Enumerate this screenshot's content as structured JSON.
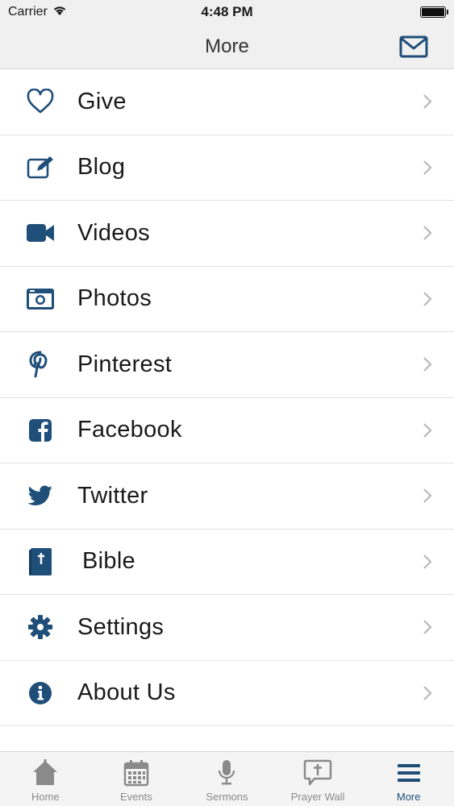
{
  "status_bar": {
    "carrier": "Carrier",
    "time": "4:48 PM"
  },
  "nav": {
    "title": "More"
  },
  "colors": {
    "accent": "#1f4e79",
    "tab_inactive": "#8a8a8a"
  },
  "menu": [
    {
      "label": "Give",
      "icon": "heart-icon"
    },
    {
      "label": "Blog",
      "icon": "edit-icon"
    },
    {
      "label": "Videos",
      "icon": "video-camera-icon"
    },
    {
      "label": "Photos",
      "icon": "camera-icon"
    },
    {
      "label": "Pinterest",
      "icon": "pinterest-icon"
    },
    {
      "label": "Facebook",
      "icon": "facebook-icon"
    },
    {
      "label": "Twitter",
      "icon": "twitter-icon"
    },
    {
      "label": "Bible",
      "icon": "bible-icon"
    },
    {
      "label": "Settings",
      "icon": "gear-icon"
    },
    {
      "label": "About Us",
      "icon": "info-icon"
    }
  ],
  "tabs": [
    {
      "label": "Home",
      "icon": "home-icon",
      "active": false
    },
    {
      "label": "Events",
      "icon": "calendar-icon",
      "active": false
    },
    {
      "label": "Sermons",
      "icon": "microphone-icon",
      "active": false
    },
    {
      "label": "Prayer Wall",
      "icon": "prayer-icon",
      "active": false
    },
    {
      "label": "More",
      "icon": "menu-icon",
      "active": true
    }
  ]
}
